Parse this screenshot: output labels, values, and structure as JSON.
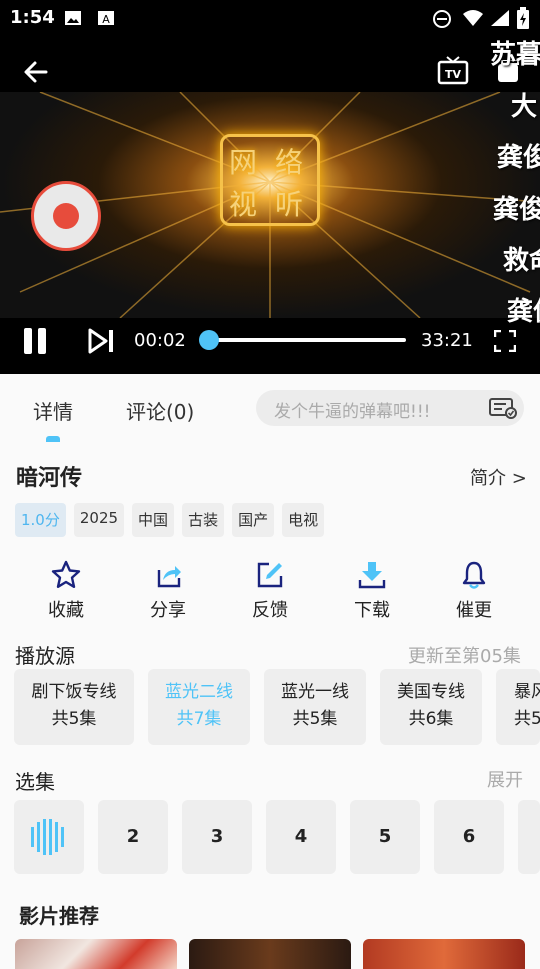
{
  "status_bar": {
    "time": "1:54"
  },
  "player": {
    "logo_chars": [
      "网",
      "络",
      "视",
      "听"
    ],
    "danmaku": [
      "苏暮",
      "大",
      "龚俊",
      "龚俊",
      "救命",
      "龚俊"
    ],
    "current_time": "00:02",
    "total_time": "33:21",
    "progress": 0.001
  },
  "tabs": [
    {
      "label": "详情"
    },
    {
      "label": "评论(0)"
    }
  ],
  "danmaku_input": {
    "placeholder": "发个牛逼的弹幕吧!!!"
  },
  "detail": {
    "title": "暗河传",
    "intro_link": "简介 >",
    "tags": [
      "1.0分",
      "2025",
      "中国",
      "古装",
      "国产",
      "电视"
    ]
  },
  "actions": [
    {
      "label": "收藏",
      "icon": "star-icon"
    },
    {
      "label": "分享",
      "icon": "share-icon"
    },
    {
      "label": "反馈",
      "icon": "edit-icon"
    },
    {
      "label": "下载",
      "icon": "download-icon"
    },
    {
      "label": "催更",
      "icon": "bell-icon"
    }
  ],
  "sources_section": {
    "title": "播放源",
    "update_text": "更新至第05集",
    "sources": [
      {
        "name": "剧下饭专线",
        "count": "共5集"
      },
      {
        "name": "蓝光二线",
        "count": "共7集"
      },
      {
        "name": "蓝光一线",
        "count": "共5集"
      },
      {
        "name": "美国专线",
        "count": "共6集"
      },
      {
        "name": "暴风",
        "count": "共5"
      }
    ]
  },
  "episodes_section": {
    "title": "选集",
    "expand": "展开",
    "episodes": [
      "2",
      "3",
      "4",
      "5",
      "6"
    ]
  },
  "recommend_title": "影片推荐",
  "colors": {
    "accent": "#4fc3f7",
    "record": "#e74c3c"
  }
}
